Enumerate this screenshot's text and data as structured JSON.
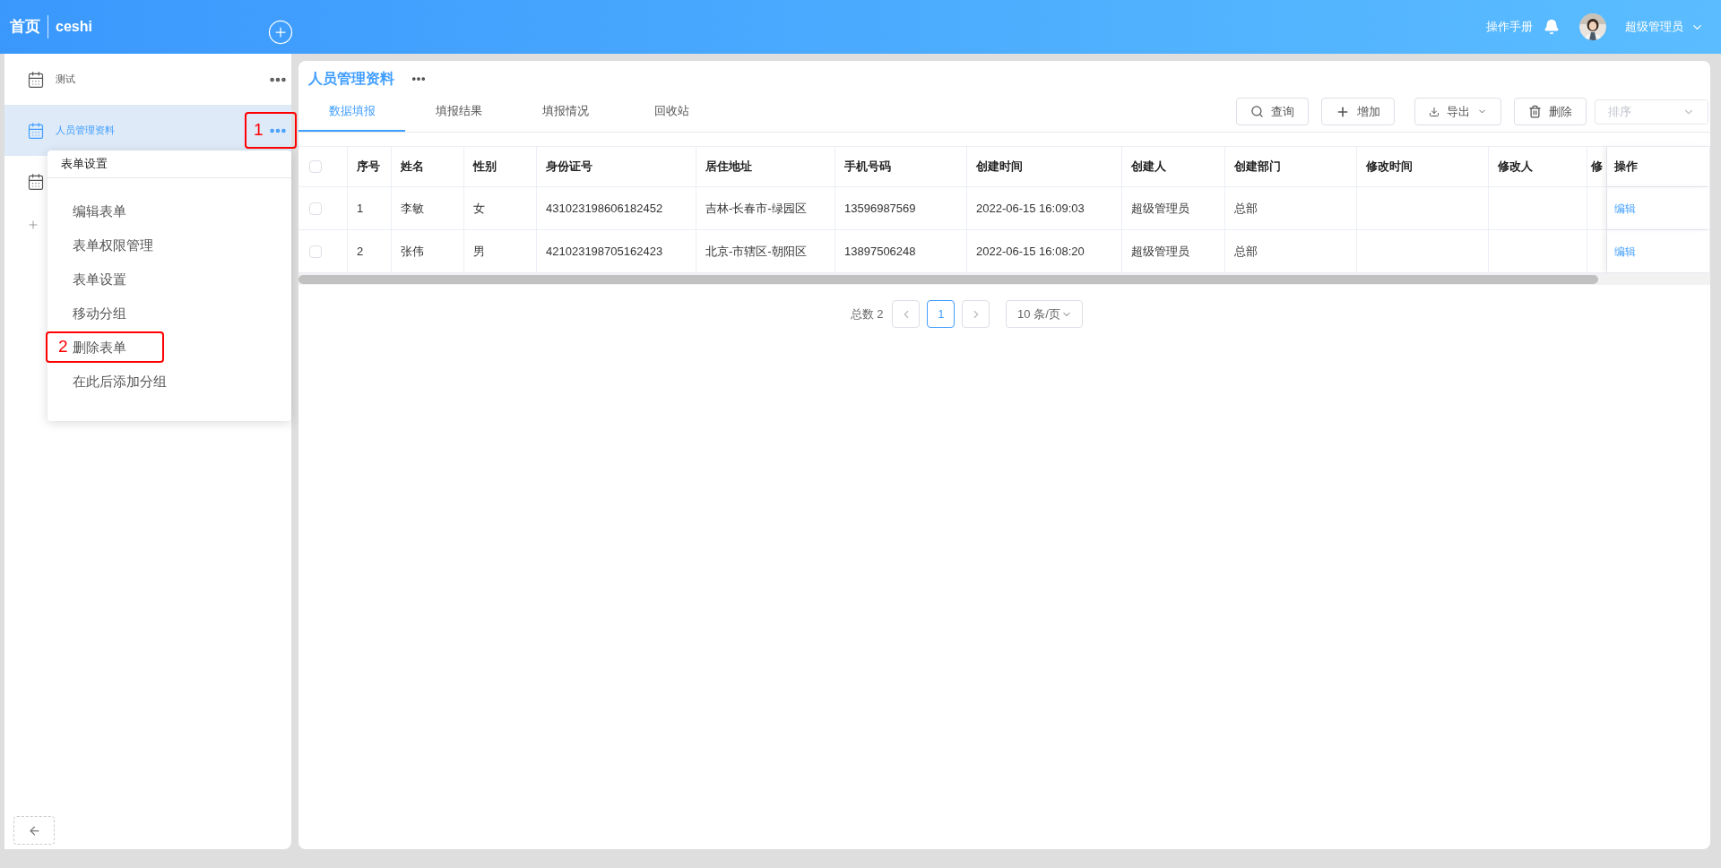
{
  "header": {
    "home": "首页",
    "app_name": "ceshi",
    "manual": "操作手册",
    "user": "超级管理员"
  },
  "sidebar": {
    "items": [
      {
        "label": "测试",
        "selected": false
      },
      {
        "label": "人员管理资料",
        "selected": true
      },
      {
        "selected": false
      }
    ]
  },
  "menu": {
    "title": "表单设置",
    "items": [
      {
        "label": "编辑表单"
      },
      {
        "label": "表单权限管理"
      },
      {
        "label": "表单设置"
      },
      {
        "label": "移动分组"
      },
      {
        "label": "删除表单",
        "callout": "2"
      },
      {
        "label": "在此后添加分组"
      }
    ]
  },
  "more_callout": "1",
  "page": {
    "title": "人员管理资料",
    "tabs": [
      {
        "label": "数据填报",
        "selected": true
      },
      {
        "label": "填报结果",
        "selected": false
      },
      {
        "label": "填报情况",
        "selected": false
      },
      {
        "label": "回收站",
        "selected": false
      }
    ],
    "toolbar": [
      {
        "label": "查询",
        "kind": "search"
      },
      {
        "label": "增加",
        "kind": "add"
      },
      {
        "label": "导出",
        "kind": "export"
      },
      {
        "label": "删除",
        "kind": "delete"
      }
    ],
    "sort_placeholder": "排序"
  },
  "table": {
    "all_checked": false,
    "columns": [
      "序号",
      "姓名",
      "性别",
      "身份证号",
      "居住地址",
      "手机号码",
      "创建时间",
      "创建人",
      "创建部门",
      "修改时间",
      "修改人",
      "修",
      "操作"
    ],
    "rows": [
      {
        "checked": false,
        "index": "1",
        "name": "李敏",
        "gender": "女",
        "id_number": "431023198606182452",
        "address": "吉林-长春市-绿园区",
        "phone": "13596987569",
        "created_at": "2022-06-15 16:09:03",
        "creator": "超级管理员",
        "department": "总部",
        "action": "编辑"
      },
      {
        "checked": false,
        "index": "2",
        "name": "张伟",
        "gender": "男",
        "id_number": "421023198705162423",
        "address": "北京-市辖区-朝阳区",
        "phone": "13897506248",
        "created_at": "2022-06-15 16:08:20",
        "creator": "超级管理员",
        "department": "总部",
        "action": "编辑"
      }
    ]
  },
  "pagination": {
    "total": "总数 2",
    "pages": [
      {
        "label": "1",
        "selected": true
      }
    ],
    "page_size": "10 条/页"
  }
}
